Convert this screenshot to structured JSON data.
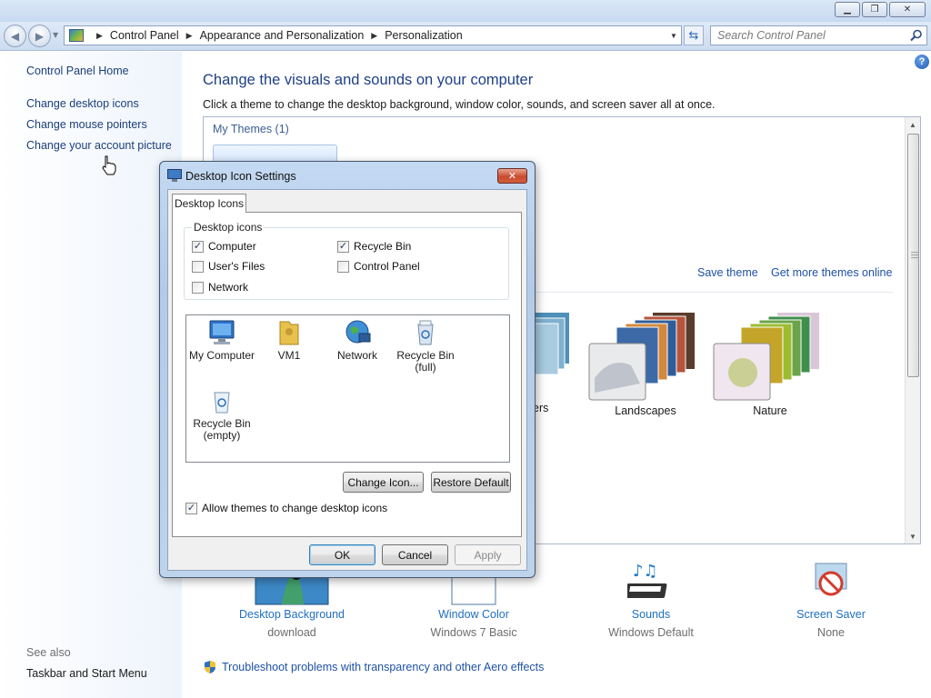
{
  "window": {
    "minimize_icon": "minimize-icon",
    "maximize_icon": "restore-icon",
    "close_icon": "close-icon"
  },
  "address": {
    "breadcrumbs": [
      "Control Panel",
      "Appearance and Personalization",
      "Personalization"
    ],
    "search_placeholder": "Search Control Panel"
  },
  "left_pane": {
    "home": "Control Panel Home",
    "links": [
      "Change desktop icons",
      "Change mouse pointers",
      "Change your account picture"
    ],
    "see_also_label": "See also",
    "see_also_links": [
      "Taskbar and Start Menu"
    ]
  },
  "main": {
    "title": "Change the visuals and sounds on your computer",
    "subtitle": "Click a theme to change the desktop background, window color, sounds, and screen saver all at once.",
    "my_themes_label": "My Themes (1)",
    "save_theme": "Save theme",
    "get_more": "Get more themes online",
    "themes": [
      "ers",
      "Landscapes",
      "Nature"
    ],
    "bottom_items": [
      {
        "label": "Desktop Background",
        "sub": "download"
      },
      {
        "label": "Window Color",
        "sub": "Windows 7 Basic"
      },
      {
        "label": "Sounds",
        "sub": "Windows Default"
      },
      {
        "label": "Screen Saver",
        "sub": "None"
      }
    ],
    "troubleshoot": "Troubleshoot problems with transparency and other Aero effects"
  },
  "dialog": {
    "title": "Desktop Icon Settings",
    "tab": "Desktop Icons",
    "group_label": "Desktop icons",
    "checkboxes": [
      {
        "label": "Computer",
        "checked": true
      },
      {
        "label": "Recycle Bin",
        "checked": true
      },
      {
        "label": "User's Files",
        "checked": false
      },
      {
        "label": "Control Panel",
        "checked": false
      },
      {
        "label": "Network",
        "checked": false
      }
    ],
    "icons": [
      {
        "line1": "My Computer",
        "line2": ""
      },
      {
        "line1": "VM1",
        "line2": ""
      },
      {
        "line1": "Network",
        "line2": ""
      },
      {
        "line1": "Recycle Bin",
        "line2": "(full)"
      },
      {
        "line1": "Recycle Bin",
        "line2": "(empty)"
      }
    ],
    "change_icon": "Change Icon...",
    "restore_default": "Restore Default",
    "allow_themes": "Allow themes to change desktop icons",
    "allow_themes_checked": true,
    "ok": "OK",
    "cancel": "Cancel",
    "apply": "Apply"
  },
  "colors": {
    "link": "#1f52a5",
    "title_blue": "#1e3f87",
    "dialog_frame": "#bed3ec"
  }
}
